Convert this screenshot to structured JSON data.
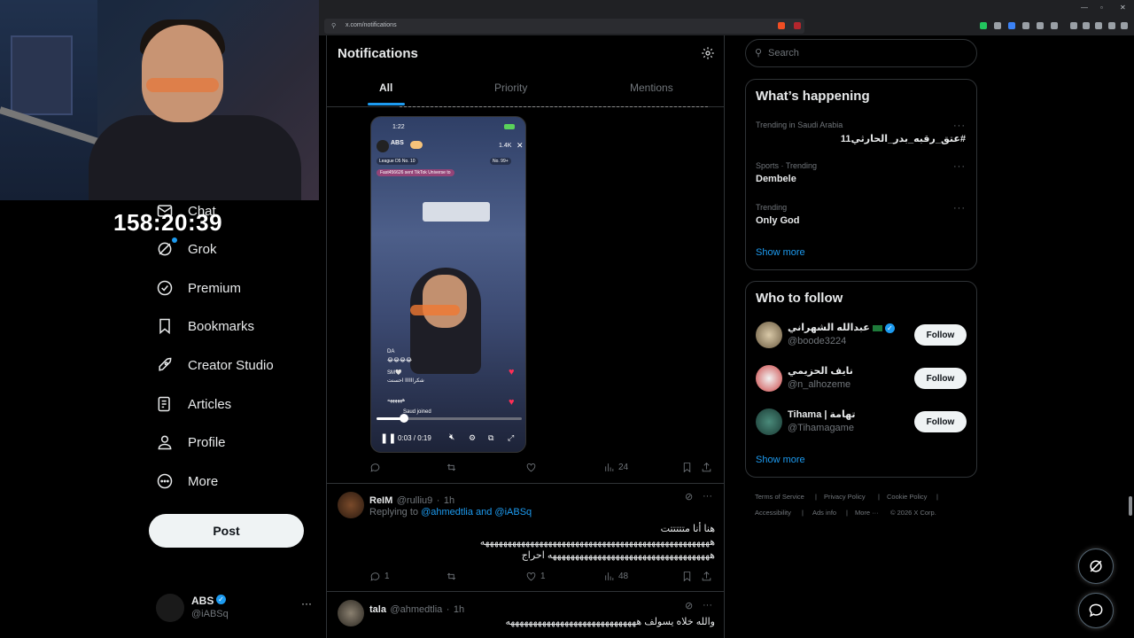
{
  "browser": {
    "url": "x.com/notifications"
  },
  "stream": {
    "timer": "158:20:39"
  },
  "nav": {
    "items": [
      {
        "label": "Chat",
        "icon": "envelope-icon"
      },
      {
        "label": "Grok",
        "icon": "grok-icon"
      },
      {
        "label": "Premium",
        "icon": "premium-icon"
      },
      {
        "label": "Bookmarks",
        "icon": "bookmark-icon"
      },
      {
        "label": "Creator Studio",
        "icon": "rocket-icon"
      },
      {
        "label": "Articles",
        "icon": "article-icon"
      },
      {
        "label": "Profile",
        "icon": "person-icon"
      },
      {
        "label": "More",
        "icon": "more-circle-icon"
      }
    ],
    "post_label": "Post",
    "account": {
      "name": "ABS",
      "handle": "@iABSq"
    }
  },
  "notifications": {
    "title": "Notifications",
    "tabs": [
      "All",
      "Priority",
      "Mentions"
    ],
    "video": {
      "status_time": "1:22",
      "profile_name": "ABS",
      "viewers": "1.4K",
      "league": "League D5 No. 10",
      "rank": "No. 99+",
      "gift_banner": "Fast456626 sent TikTok Universe to",
      "chat_1": "DA",
      "chat_2": "😂😂😂😂",
      "chat_3": "SM🤍",
      "chat_4": "شكراااااا احسنت",
      "chat_5": "ههههههه",
      "joined": "Saud joined",
      "time": "0:03 / 0:19"
    },
    "first_tweet_actions": {
      "reply": "",
      "retweet": "",
      "like": "",
      "views": "24"
    },
    "tweets": [
      {
        "name": "ReIM",
        "handle": "@rulliu9",
        "time": "1h",
        "replying_prefix": "Replying to",
        "replying_to": "@ahmedtlia and @iABSq",
        "line1": "هنا أنا متتتتتت",
        "line2": "هههههههههههههههههههههههههههههههههههههههههههههههههههه",
        "line3": "ههههههههههههههههههههههههههههههههههههه احراج",
        "replies": "1",
        "retweets": "",
        "likes": "1",
        "views": "48"
      },
      {
        "name": "tala",
        "handle": "@ahmedtlia",
        "time": "1h",
        "line1": "والله خلاه يسولف هههههههههههههههههههههههههههههه"
      }
    ]
  },
  "sidebar": {
    "search_placeholder": "Search",
    "happening_title": "What’s happening",
    "trends": [
      {
        "meta": "Trending in Saudi Arabia",
        "name": "#عتق_رقبه_بدر_الحارثي11"
      },
      {
        "meta": "Sports · Trending",
        "name": "Dembele"
      },
      {
        "meta": "Trending",
        "name": "Only God"
      }
    ],
    "show_more": "Show more",
    "follow_title": "Who to follow",
    "follows": [
      {
        "name": "عبدالله الشهراني",
        "handle": "@boode3224",
        "button": "Follow"
      },
      {
        "name": "نايف الحزيمي",
        "handle": "@n_alhozeme",
        "button": "Follow"
      },
      {
        "name": "Tihama | تهامة",
        "handle": "@Tihamagame",
        "button": "Follow"
      }
    ],
    "follow_show_more": "Show more",
    "footer": [
      "Terms of Service",
      "Privacy Policy",
      "Cookie Policy",
      "Accessibility",
      "Ads info",
      "More ···",
      "© 2026 X Corp."
    ]
  },
  "colors": {
    "accent": "#1d9bf0",
    "background": "#000000",
    "border": "#2f3336",
    "verified": "#1d9bf0"
  }
}
